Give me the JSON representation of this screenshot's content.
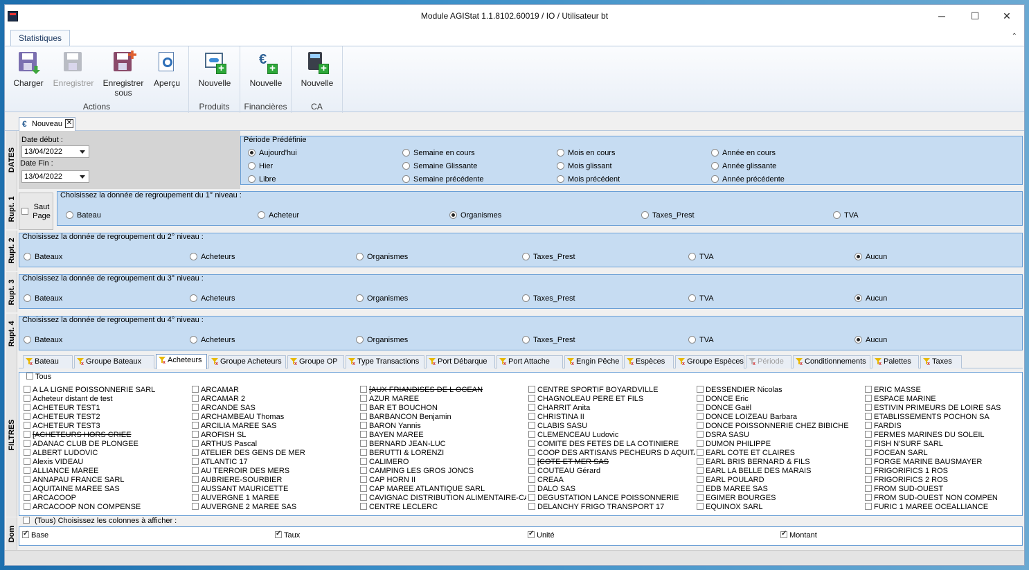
{
  "window": {
    "title": "Module AGIStat 1.1.8102.60019 / IO / Utilisateur bt",
    "min": "─",
    "max": "☐",
    "close": "✕",
    "collapse": "⌃"
  },
  "ribbon": {
    "tab": "Statistiques",
    "groups": [
      {
        "label": "Actions",
        "buttons": [
          {
            "label": "Charger"
          },
          {
            "label": "Enregistrer"
          },
          {
            "label": "Enregistrer sous"
          },
          {
            "label": "Aperçu"
          }
        ]
      },
      {
        "label": "Produits",
        "buttons": [
          {
            "label": "Nouvelle"
          }
        ]
      },
      {
        "label": "Financières",
        "buttons": [
          {
            "label": "Nouvelle"
          }
        ]
      },
      {
        "label": "CA",
        "buttons": [
          {
            "label": "Nouvelle"
          }
        ]
      }
    ]
  },
  "doc_tab": {
    "label": "Nouveau",
    "icon": "€",
    "close": "✕"
  },
  "dates": {
    "side": "DATES",
    "start_label": "Date début :",
    "start_value": "13/04/2022",
    "end_label": "Date Fin :",
    "end_value": "13/04/2022",
    "period_legend": "Période Prédéfinie",
    "options": [
      "Aujourd'hui",
      "Semaine en cours",
      "Mois en cours",
      "Année en cours",
      "Hier",
      "Semaine Glissante",
      "Mois glissant",
      "Année glissante",
      "Libre",
      "Semaine précédente",
      "Mois précédent",
      "Année précédente"
    ],
    "selected": "Aujourd'hui"
  },
  "rupt1": {
    "side": "Rupt. 1",
    "saut_label": "Saut Page",
    "legend": "Choisissez la donnée de regroupement du 1° niveau :",
    "options": [
      "Bateau",
      "Acheteur",
      "Organismes",
      "Taxes_Prest",
      "TVA"
    ],
    "selected": "Organismes"
  },
  "rupt2": {
    "side": "Rupt. 2",
    "legend": "Choisissez la donnée de regroupement du 2° niveau :",
    "options": [
      "Bateaux",
      "Acheteurs",
      "Organismes",
      "Taxes_Prest",
      "TVA",
      "Aucun"
    ],
    "selected": "Aucun"
  },
  "rupt3": {
    "side": "Rupt. 3",
    "legend": "Choisissez la donnée de regroupement du 3° niveau :",
    "options": [
      "Bateaux",
      "Acheteurs",
      "Organismes",
      "Taxes_Prest",
      "TVA",
      "Aucun"
    ],
    "selected": "Aucun"
  },
  "rupt4": {
    "side": "Rupt. 4",
    "legend": "Choisissez la donnée de regroupement du 4° niveau :",
    "options": [
      "Bateaux",
      "Acheteurs",
      "Organismes",
      "Taxes_Prest",
      "TVA",
      "Aucun"
    ],
    "selected": "Aucun"
  },
  "filters": {
    "side": "FILTRES",
    "tabs": [
      {
        "label": "Bateau"
      },
      {
        "label": "Groupe Bateaux"
      },
      {
        "label": "Acheteurs",
        "active": true
      },
      {
        "label": "Groupe Acheteurs"
      },
      {
        "label": "Groupe OP"
      },
      {
        "label": "Type Transactions"
      },
      {
        "label": "Port Débarque"
      },
      {
        "label": "Port Attache"
      },
      {
        "label": "Engin Pêche"
      },
      {
        "label": "Espèces"
      },
      {
        "label": "Groupe Espèces"
      },
      {
        "label": "Période",
        "disabled": true
      },
      {
        "label": "Conditionnements"
      },
      {
        "label": "Palettes"
      },
      {
        "label": "Taxes"
      }
    ],
    "all_label": "Tous",
    "columns": [
      [
        "A LA LIGNE POISSONNERIE SARL",
        "Acheteur distant de test",
        "ACHETEUR TEST1",
        "ACHETEUR TEST2",
        "ACHETEUR TEST3",
        "[ACHETEURS HORS CRIEE",
        "ADANAC CLUB DE PLONGEE",
        "ALBERT LUDOVIC",
        "Alexis VIDEAU",
        "ALLIANCE MAREE",
        "ANNAPAU FRANCE SARL",
        "AQUITAINE MAREE SAS",
        "ARCACOOP",
        "ARCACOOP NON COMPENSE"
      ],
      [
        "ARCAMAR",
        "ARCAMAR 2",
        "ARCANDE SAS",
        "ARCHAMBEAU Thomas",
        "ARCILIA MAREE SAS",
        "AROFISH SL",
        "ARTHUS Pascal",
        "ATELIER DES GENS DE MER",
        "ATLANTIC 17",
        "AU TERROIR DES MERS",
        "AUBRIERE-SOURBIER",
        "AUSSANT    MAURICETTE",
        "AUVERGNE 1 MAREE",
        "AUVERGNE 2 MAREE SAS"
      ],
      [
        "[AUX FRIANDISES DE L OCEAN",
        "AZUR MAREE",
        "BAR ET BOUCHON",
        "BARBANCON Benjamin",
        "BARON Yannis",
        "BAYEN MAREE",
        "BERNARD JEAN-LUC",
        "BERUTTI & LORENZI",
        "CALIMERO",
        "CAMPING LES GROS JONCS",
        "CAP HORN II",
        "CAP MAREE ATLANTIQUE SARL",
        "CAVIGNAC DISTRIBUTION ALIMENTAIRE-CADIA",
        "CENTRE LECLERC"
      ],
      [
        "CENTRE SPORTIF BOYARDVILLE",
        "CHAGNOLEAU PERE ET FILS",
        "CHARRIT Anita",
        "CHRISTINA II",
        "CLABIS SASU",
        "CLEMENCEAU Ludovic",
        "COMITE DES FETES DE LA COTINIERE",
        "COOP DES ARTISANS PECHEURS D AQUITAINE",
        "[COTE ET MER SAS",
        "COUTEAU Gérard",
        "CREAA",
        "DALO SAS",
        "DEGUSTATION LANCE POISSONNERIE",
        "DELANCHY FRIGO TRANSPORT 17"
      ],
      [
        "DESSENDIER Nicolas",
        "DONCE Eric",
        "DONCE Gaël",
        "DONCE LOIZEAU Barbara",
        "DONCE POISSONNERIE CHEZ BIBICHE",
        "DSRA SASU",
        "DUMON PHILIPPE",
        "EARL   COTE ET CLAIRES",
        "EARL BRIS BERNARD & FILS",
        "EARL LA BELLE DES MARAIS",
        "EARL POULARD",
        "EDB MAREE SAS",
        "EGIMER  BOURGES",
        "EQUINOX SARL"
      ],
      [
        "ERIC MASSE",
        "ESPACE MARINE",
        "ESTIVIN PRIMEURS DE LOIRE SAS",
        "ETABLISSEMENTS POCHON SA",
        "FARDIS",
        "FERMES MARINES DU SOLEIL",
        "FISH N'SURF SARL",
        "FOCEAN SARL",
        "FORGE MARINE BAUSMAYER",
        "FRIGORIFICS 1 ROS",
        "FRIGORIFICS 2 ROS",
        "FROM SUD-OUEST",
        "FROM SUD-OUEST NON COMPEN",
        "FURIC 1  MAREE OCEALLIANCE"
      ]
    ],
    "struck": [
      "[ACHETEURS HORS CRIEE",
      "[AUX FRIANDISES DE L OCEAN",
      "[COTE ET MER SAS"
    ]
  },
  "dom": {
    "side": "Dom",
    "all_label": "(Tous) Choisissez les colonnes à afficher :",
    "columns": [
      "Base",
      "Taux",
      "Unité",
      "Montant"
    ]
  }
}
